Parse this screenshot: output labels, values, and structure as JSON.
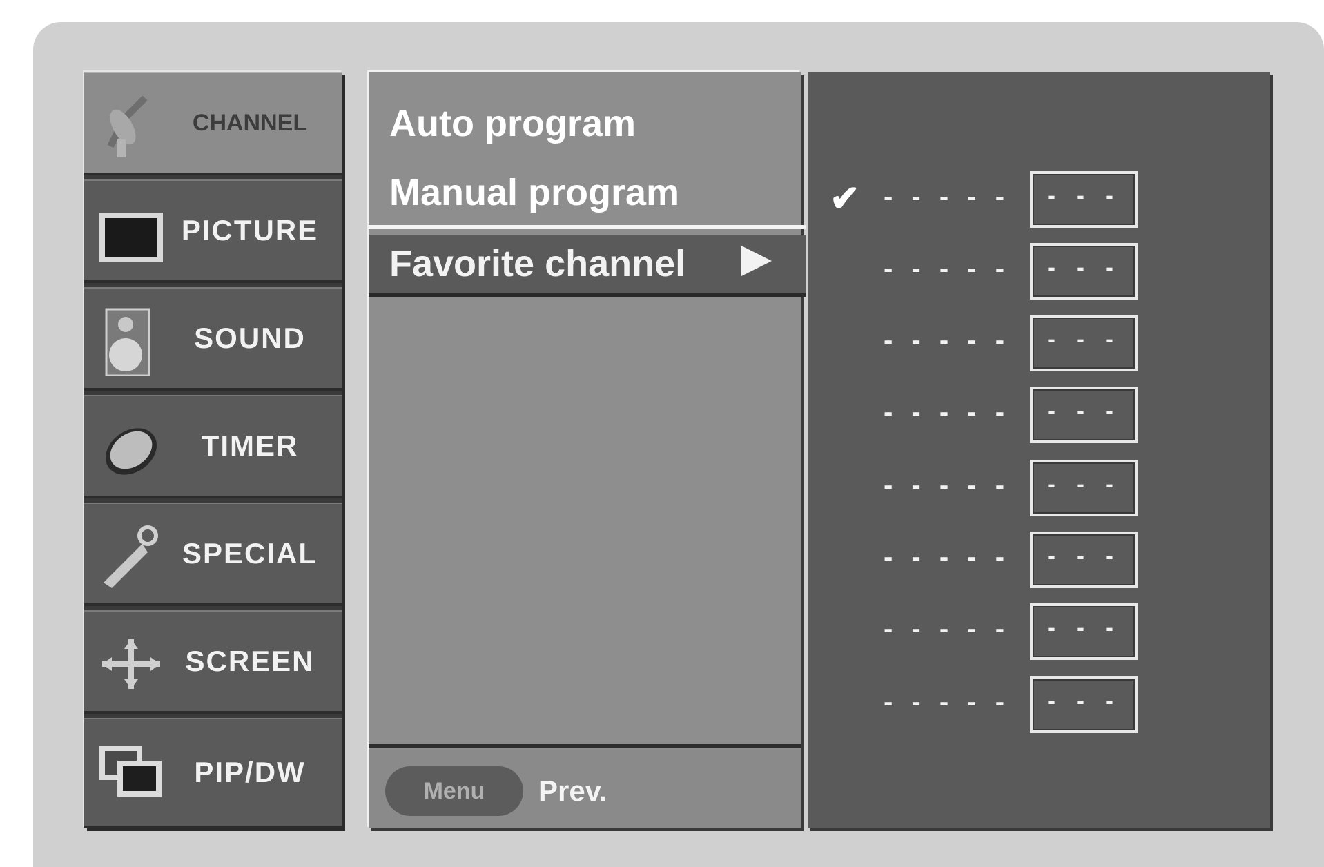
{
  "categories": [
    {
      "label": "CHANNEL",
      "icon": "satellite-dish-icon",
      "active": true
    },
    {
      "label": "PICTURE",
      "icon": "monitor-icon",
      "active": false
    },
    {
      "label": "SOUND",
      "icon": "speaker-icon",
      "active": false
    },
    {
      "label": "TIMER",
      "icon": "clock-icon",
      "active": false
    },
    {
      "label": "SPECIAL",
      "icon": "key-icon",
      "active": false
    },
    {
      "label": "SCREEN",
      "icon": "move-arrows-icon",
      "active": false
    },
    {
      "label": "PIP/DW",
      "icon": "pip-windows-icon",
      "active": false
    }
  ],
  "submenu": {
    "auto_program": "Auto program",
    "manual_program": "Manual program",
    "favorite_channel": "Favorite channel"
  },
  "footer": {
    "menu_button": "Menu",
    "prev_label": "Prev."
  },
  "favorites": [
    {
      "name": "- - - - -",
      "number": "- - -",
      "checked": true
    },
    {
      "name": "- - - - -",
      "number": "- - -",
      "checked": false
    },
    {
      "name": "- - - - -",
      "number": "- - -",
      "checked": false
    },
    {
      "name": "- - - - -",
      "number": "- - -",
      "checked": false
    },
    {
      "name": "- - - - -",
      "number": "- - -",
      "checked": false
    },
    {
      "name": "- - - - -",
      "number": "- - -",
      "checked": false
    },
    {
      "name": "- - - - -",
      "number": "- - -",
      "checked": false
    },
    {
      "name": "- - - - -",
      "number": "- - -",
      "checked": false
    }
  ],
  "check_mark": "✔",
  "colors": {
    "background": "#d0d0d0",
    "active_category": "#8c8c8c",
    "category": "#5a5a5a",
    "submenu": "#8e8e8e",
    "text": "#f2f2f2"
  }
}
